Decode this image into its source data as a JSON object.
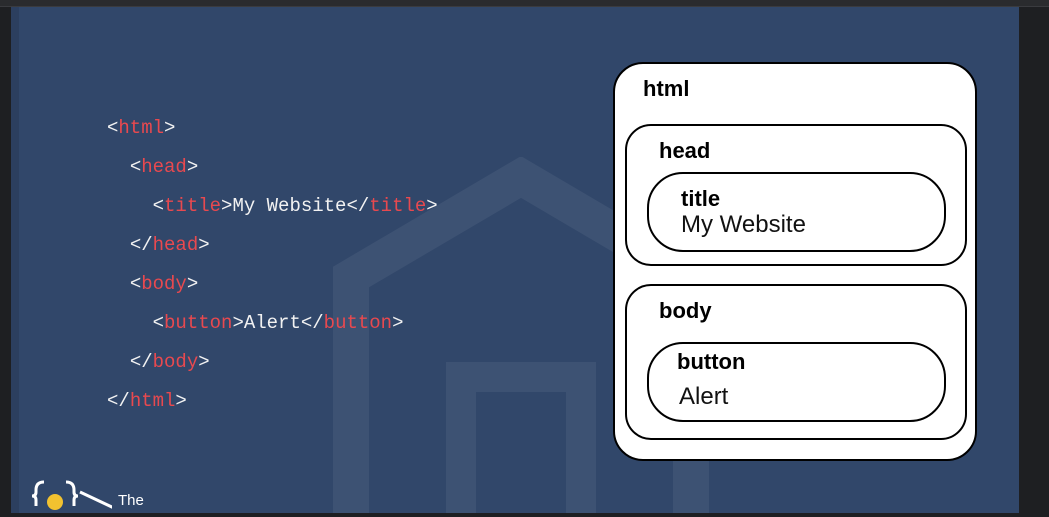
{
  "code_listing": {
    "lines": [
      {
        "indent": "",
        "open": "<",
        "tag": "html",
        "close": ">",
        "text": "",
        "open2": "",
        "tag2": "",
        "close2": ""
      },
      {
        "indent": "  ",
        "open": "<",
        "tag": "head",
        "close": ">",
        "text": "",
        "open2": "",
        "tag2": "",
        "close2": ""
      },
      {
        "indent": "    ",
        "open": "<",
        "tag": "title",
        "close": ">",
        "text": "My Website",
        "open2": "</",
        "tag2": "title",
        "close2": ">"
      },
      {
        "indent": "  ",
        "open": "</",
        "tag": "head",
        "close": ">",
        "text": "",
        "open2": "",
        "tag2": "",
        "close2": ""
      },
      {
        "indent": "  ",
        "open": "<",
        "tag": "body",
        "close": ">",
        "text": "",
        "open2": "",
        "tag2": "",
        "close2": ""
      },
      {
        "indent": "    ",
        "open": "<",
        "tag": "button",
        "close": ">",
        "text": "Alert",
        "open2": "</",
        "tag2": "button",
        "close2": ">"
      },
      {
        "indent": "  ",
        "open": "</",
        "tag": "body",
        "close": ">",
        "text": "",
        "open2": "",
        "tag2": "",
        "close2": ""
      },
      {
        "indent": "",
        "open": "</",
        "tag": "html",
        "close": ">",
        "text": "",
        "open2": "",
        "tag2": "",
        "close2": ""
      }
    ]
  },
  "dom_tree": {
    "root_label": "html",
    "head": {
      "label": "head",
      "child": {
        "label": "title",
        "text": "My Website"
      }
    },
    "body": {
      "label": "body",
      "child": {
        "label": "button",
        "text": "Alert"
      }
    }
  },
  "logo": {
    "text": "The"
  },
  "colors": {
    "slide_background": "#31476a",
    "tag_color": "#e8494f",
    "code_text": "#f2f2f2"
  }
}
